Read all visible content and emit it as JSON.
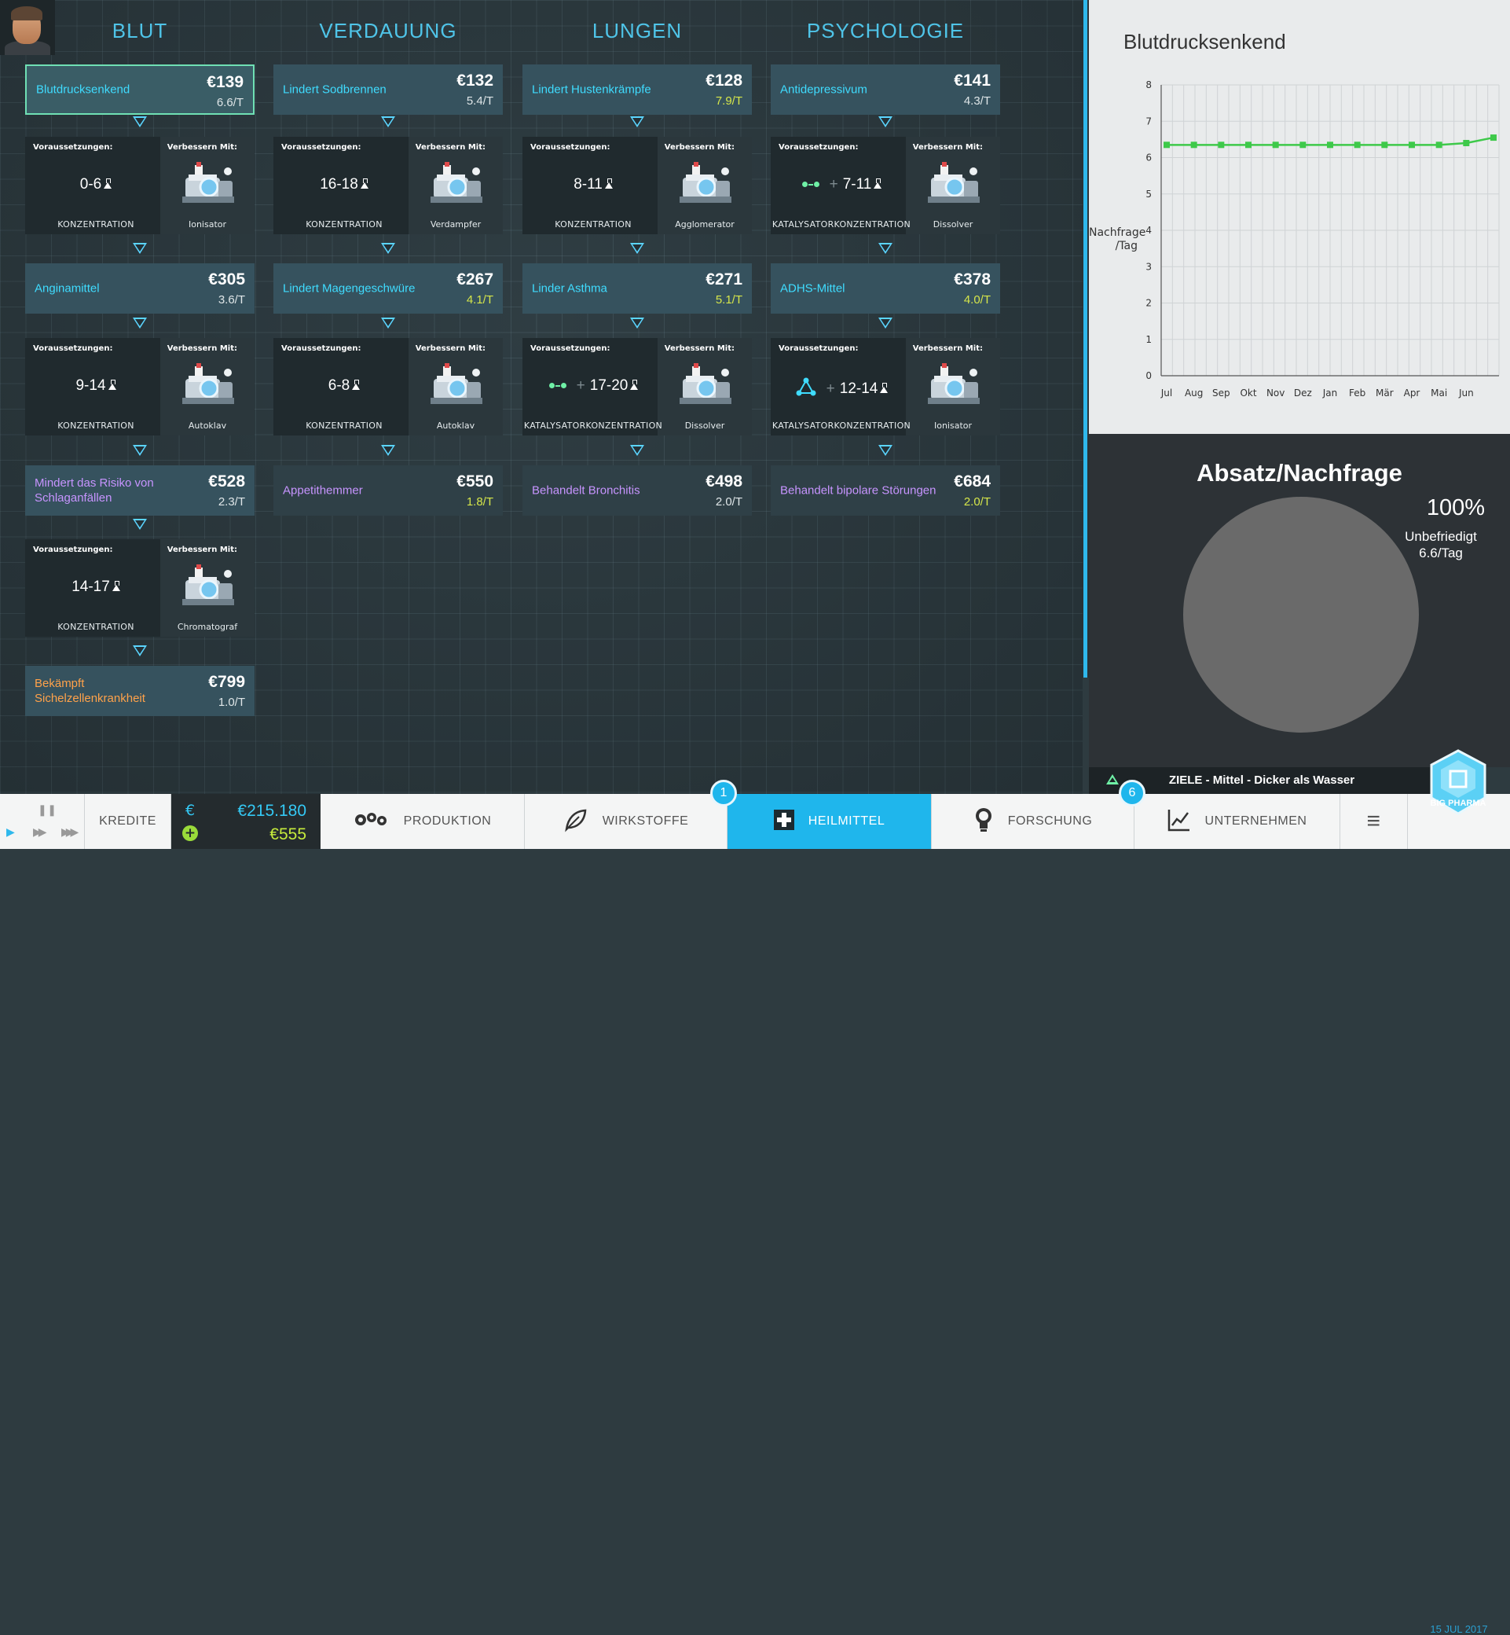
{
  "columns": [
    {
      "title": "BLUT",
      "items": [
        {
          "name": "Blutdrucksenkend",
          "price": "€139",
          "demand": "6.6/T",
          "color": "cyan",
          "demandColor": "white",
          "selected": true
        },
        {
          "req": {
            "value": "0-6",
            "type": "KONZENTRATION",
            "machine": "Ionisator",
            "catalyst": false
          }
        },
        {
          "name": "Anginamittel",
          "price": "€305",
          "demand": "3.6/T",
          "color": "cyan",
          "demandColor": "white"
        },
        {
          "req": {
            "value": "9-14",
            "type": "KONZENTRATION",
            "machine": "Autoklav",
            "catalyst": false
          }
        },
        {
          "name": "Mindert das Risiko von Schlaganfällen",
          "price": "€528",
          "demand": "2.3/T",
          "color": "violet",
          "demandColor": "white"
        },
        {
          "req": {
            "value": "14-17",
            "type": "KONZENTRATION",
            "machine": "Chromatograf",
            "catalyst": false
          }
        },
        {
          "name": "Bekämpft Sichelzellenkrankheit",
          "price": "€799",
          "demand": "1.0/T",
          "color": "orange",
          "demandColor": "white"
        }
      ]
    },
    {
      "title": "VERDAUUNG",
      "items": [
        {
          "name": "Lindert Sodbrennen",
          "price": "€132",
          "demand": "5.4/T",
          "color": "cyan",
          "demandColor": "white"
        },
        {
          "req": {
            "value": "16-18",
            "type": "KONZENTRATION",
            "machine": "Verdampfer",
            "catalyst": false
          }
        },
        {
          "name": "Lindert Magengeschwüre",
          "price": "€267",
          "demand": "4.1/T",
          "color": "cyan",
          "demandColor": "yellow"
        },
        {
          "req": {
            "value": "6-8",
            "type": "KONZENTRATION",
            "machine": "Autoklav",
            "catalyst": false
          }
        },
        {
          "name": "Appetithemmer",
          "price": "€550",
          "demand": "1.8/T",
          "color": "violet",
          "demandColor": "yellow",
          "dim": true
        }
      ]
    },
    {
      "title": "LUNGEN",
      "items": [
        {
          "name": "Lindert Hustenkrämpfe",
          "price": "€128",
          "demand": "7.9/T",
          "color": "cyan",
          "demandColor": "yellow"
        },
        {
          "req": {
            "value": "8-11",
            "type": "KONZENTRATION",
            "machine": "Agglomerator",
            "catalyst": false
          }
        },
        {
          "name": "Linder Asthma",
          "price": "€271",
          "demand": "5.1/T",
          "color": "cyan",
          "demandColor": "yellow"
        },
        {
          "req": {
            "value": "17-20",
            "type": "KATALYSATORKONZENTRATION",
            "machine": "Dissolver",
            "catalyst": true
          }
        },
        {
          "name": "Behandelt Bronchitis",
          "price": "€498",
          "demand": "2.0/T",
          "color": "violet",
          "demandColor": "white",
          "dim": true
        }
      ]
    },
    {
      "title": "PSYCHOLOGIE",
      "items": [
        {
          "name": "Antidepressivum",
          "price": "€141",
          "demand": "4.3/T",
          "color": "cyan",
          "demandColor": "white"
        },
        {
          "req": {
            "value": "7-11",
            "type": "KATALYSATORKONZENTRATION",
            "machine": "Dissolver",
            "catalyst": true
          }
        },
        {
          "name": "ADHS-Mittel",
          "price": "€378",
          "demand": "4.0/T",
          "color": "cyan",
          "demandColor": "yellow"
        },
        {
          "req": {
            "value": "12-14",
            "type": "KATALYSATORKONZENTRATION",
            "machine": "Ionisator",
            "catalyst": "triangle"
          }
        },
        {
          "name": "Behandelt bipolare Störungen",
          "price": "€684",
          "demand": "2.0/T",
          "color": "violet",
          "demandColor": "yellow",
          "dim": true
        }
      ]
    }
  ],
  "labels": {
    "prereq": "Voraussetzungen:",
    "improve": "Verbessern Mit:"
  },
  "chart_data": {
    "type": "line",
    "title": "Blutdrucksenkend",
    "ylabel": "Nachfrage /Tag",
    "categories": [
      "Jul",
      "Aug",
      "Sep",
      "Okt",
      "Nov",
      "Dez",
      "Jan",
      "Feb",
      "Mär",
      "Apr",
      "Mai",
      "Jun"
    ],
    "x": [
      "Jul",
      "Aug",
      "Sep",
      "Okt",
      "Nov",
      "Dez",
      "Jan",
      "Feb",
      "Mär",
      "Apr",
      "Mai",
      "Jun",
      ""
    ],
    "values": [
      6.35,
      6.35,
      6.35,
      6.35,
      6.35,
      6.35,
      6.35,
      6.35,
      6.35,
      6.35,
      6.35,
      6.4,
      6.55
    ],
    "ylim": [
      0,
      8
    ],
    "yticks": [
      0,
      1,
      2,
      3,
      4,
      5,
      6,
      7,
      8
    ],
    "grid": true,
    "color": "#3ec94a"
  },
  "sales": {
    "title": "Absatz/Nachfrage",
    "percent": "100%",
    "status": "Unbefriedigt",
    "demand": "6.6/Tag",
    "pie_color": "#6a6a6a"
  },
  "goals": {
    "text": "ZIELE - Mittel - Dicker als Wasser"
  },
  "bottom": {
    "credits": "KREDITE",
    "cash": "€215.180",
    "income": "€555",
    "currency_icon": "€",
    "tabs": {
      "production": "PRODUKTION",
      "ingredients": "WIRKSTOFFE",
      "cures": "HEILMITTEL",
      "research": "FORSCHUNG",
      "company": "UNTERNEHMEN"
    },
    "badge_ingredients": "1",
    "badge_research": "6",
    "date": "15 JUL 2017",
    "logo": "BIG PHARMA"
  },
  "colors": {
    "accent": "#1fb6ec",
    "cyan": "#3fdcff",
    "violet": "#c794ff",
    "orange": "#ffa24a",
    "yellow": "#d6e64a",
    "line": "#3ec94a"
  }
}
